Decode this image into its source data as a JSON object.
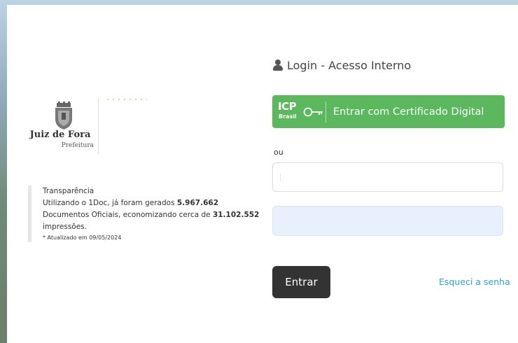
{
  "brand": {
    "name": "Juiz de Fora",
    "subtitle": "Prefeitura"
  },
  "transparency": {
    "title": "Transparência",
    "line1_pre": "Utilizando o 1Doc, já foram gerados ",
    "documents_count": "5.967.662",
    "line1_post": " Documentos Oficiais, economizando cerca de ",
    "impressions_count": "31.102.552",
    "line2_post": " impressões.",
    "updated": "* Atualizado em 09/05/2024"
  },
  "login": {
    "title": "Login - Acesso Interno",
    "cert_button_label": "Entrar com Certificado Digital",
    "cert_logo_top": "ICP",
    "cert_logo_bottom": "Brasil",
    "or_label": "ou",
    "username_value": "",
    "password_value": "",
    "submit_label": "Entrar",
    "forgot_label": "Esqueci a senha"
  },
  "colors": {
    "accent_green": "#5cb85c",
    "link_blue": "#2ba6cb",
    "button_dark": "#333333",
    "autofill_blue": "#e8f0fe"
  },
  "icons": {
    "user": "user-icon",
    "key": "key-icon",
    "crest": "crest-icon"
  }
}
